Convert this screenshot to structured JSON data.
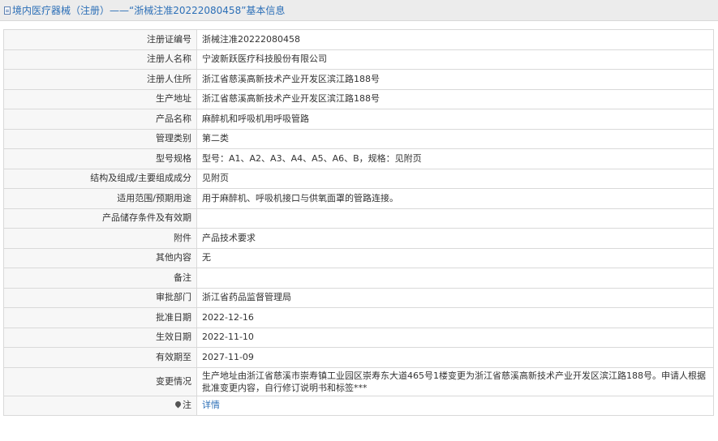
{
  "header": {
    "title": "境内医疗器械（注册）——“浙械注准20222080458”基本信息",
    "icon": "document-icon"
  },
  "rows": [
    {
      "label": "注册证编号",
      "value": "浙械注准20222080458"
    },
    {
      "label": "注册人名称",
      "value": "宁波新跃医疗科技股份有限公司"
    },
    {
      "label": "注册人住所",
      "value": "浙江省慈溪高新技术产业开发区滨江路188号"
    },
    {
      "label": "生产地址",
      "value": "浙江省慈溪高新技术产业开发区滨江路188号"
    },
    {
      "label": "产品名称",
      "value": "麻醉机和呼吸机用呼吸管路"
    },
    {
      "label": "管理类别",
      "value": "第二类"
    },
    {
      "label": "型号规格",
      "value": "型号：A1、A2、A3、A4、A5、A6、B，规格：见附页"
    },
    {
      "label": "结构及组成/主要组成成分",
      "value": "见附页"
    },
    {
      "label": "适用范围/预期用途",
      "value": "用于麻醉机、呼吸机接口与供氧面罩的管路连接。"
    },
    {
      "label": "产品储存条件及有效期",
      "value": ""
    },
    {
      "label": "附件",
      "value": "产品技术要求"
    },
    {
      "label": "其他内容",
      "value": "无"
    },
    {
      "label": "备注",
      "value": ""
    },
    {
      "label": "审批部门",
      "value": "浙江省药品监督管理局"
    },
    {
      "label": "批准日期",
      "value": "2022-12-16"
    },
    {
      "label": "生效日期",
      "value": "2022-11-10"
    },
    {
      "label": "有效期至",
      "value": "2027-11-09"
    },
    {
      "label": "变更情况",
      "value": "生产地址由浙江省慈溪市崇寿镇工业园区崇寿东大道465号1楼变更为浙江省慈溪高新技术产业开发区滨江路188号。申请人根据批准变更内容，自行修订说明书和标签***"
    }
  ],
  "note": {
    "label": "注",
    "icon": "pin-icon",
    "link": "详情"
  }
}
